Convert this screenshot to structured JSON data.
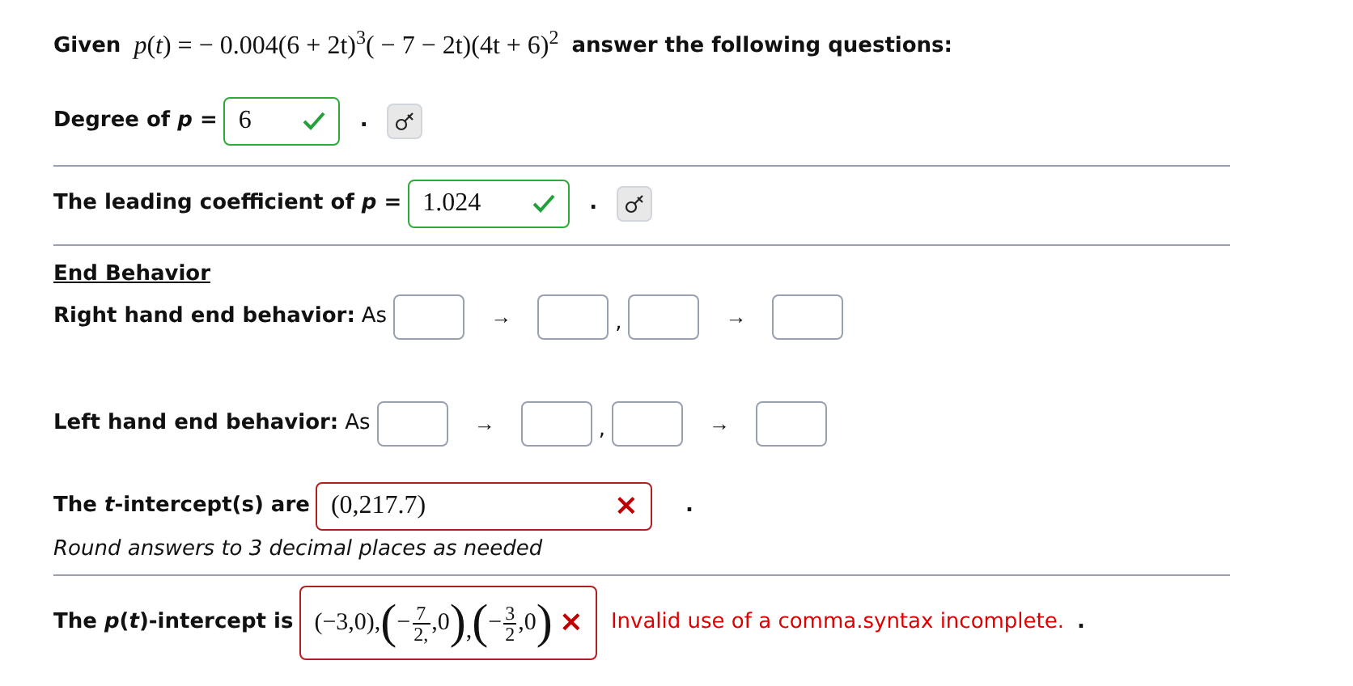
{
  "question": {
    "lead": "Given",
    "expression": "*p*(*t*) =  − 0.004(6 + 2t)$^{3}$( − 7 − 2t)(4t + 6)$^{2}$",
    "tail": "answer the following questions:"
  },
  "degree": {
    "label": "Degree of *p* =",
    "value": "6",
    "correct": true,
    "period": "."
  },
  "leading": {
    "label": "The leading coefficient of *p* =",
    "value": "1.024",
    "correct": true,
    "period": "."
  },
  "end_behavior": {
    "heading": "End Behavior",
    "rows": [
      {
        "label": "Right hand end behavior:",
        "as": "As",
        "arrow": "→",
        "separator": ","
      },
      {
        "label": "Left hand end behavior:",
        "as": "As",
        "arrow": "→",
        "separator": ","
      }
    ]
  },
  "t_intercept": {
    "label": "The *t*-intercept(s) are",
    "value": "(0,217.7)",
    "correct": false,
    "mark": "×",
    "period": ".",
    "note": "Round answers to 3 decimal places as needed"
  },
  "p_intercept": {
    "label": "The *p*(*t*)-intercept is",
    "correct": false,
    "mark": "×",
    "message": "Invalid use of a comma.syntax incomplete.",
    "period": ".",
    "parts": [
      {
        "kind": "text",
        "text": "(−3,0),"
      },
      {
        "kind": "group",
        "open": "(",
        "close": ")",
        "after": ",",
        "items": [
          {
            "kind": "text",
            "text": "−"
          },
          {
            "kind": "fraction",
            "num": "7",
            "den": "2,"
          },
          {
            "kind": "text",
            "text": ",0"
          }
        ]
      },
      {
        "kind": "group",
        "open": "(",
        "close": ")",
        "items": [
          {
            "kind": "text",
            "text": "−"
          },
          {
            "kind": "fraction",
            "num": "3",
            "den": "2"
          },
          {
            "kind": "text",
            "text": ",0"
          }
        ]
      }
    ]
  }
}
